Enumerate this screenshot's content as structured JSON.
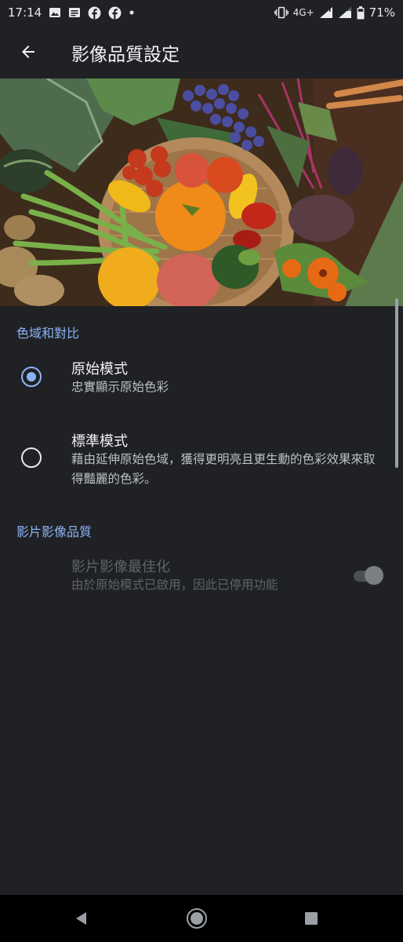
{
  "status_bar": {
    "time": "17:14",
    "network": "4G+",
    "battery": "71%",
    "left_icons": [
      "image-icon",
      "news-icon",
      "facebook-icon",
      "facebook-icon",
      "dot-icon"
    ],
    "right_icons": [
      "vibrate-icon",
      "signal-icon",
      "signal-icon",
      "battery-icon"
    ]
  },
  "app_bar": {
    "title": "影像品質設定",
    "back_icon": "arrow-left-icon"
  },
  "hero": {
    "icon": "vegetable-basket-image"
  },
  "sections": {
    "color_gamut": {
      "header": "色域和對比",
      "options": [
        {
          "title": "原始模式",
          "summary": "忠實顯示原始色彩",
          "selected": true
        },
        {
          "title": "標準模式",
          "summary": "藉由延伸原始色域，獲得更明亮且更生動的色彩效果來取得豔麗的色彩。",
          "selected": false
        }
      ]
    },
    "video": {
      "header": "影片影像品質",
      "item": {
        "title": "影片影像最佳化",
        "summary": "由於原始模式已啟用，因此已停用功能",
        "enabled": false,
        "checked": false
      }
    }
  },
  "nav_bar": {
    "icons": [
      "back-triangle-icon",
      "home-circle-icon",
      "recents-square-icon"
    ]
  },
  "colors": {
    "background": "#202124",
    "accent": "#8ab4f8",
    "text_primary": "#f1f3f4",
    "text_secondary": "#bdc1c6",
    "text_disabled": "#5f6368"
  }
}
